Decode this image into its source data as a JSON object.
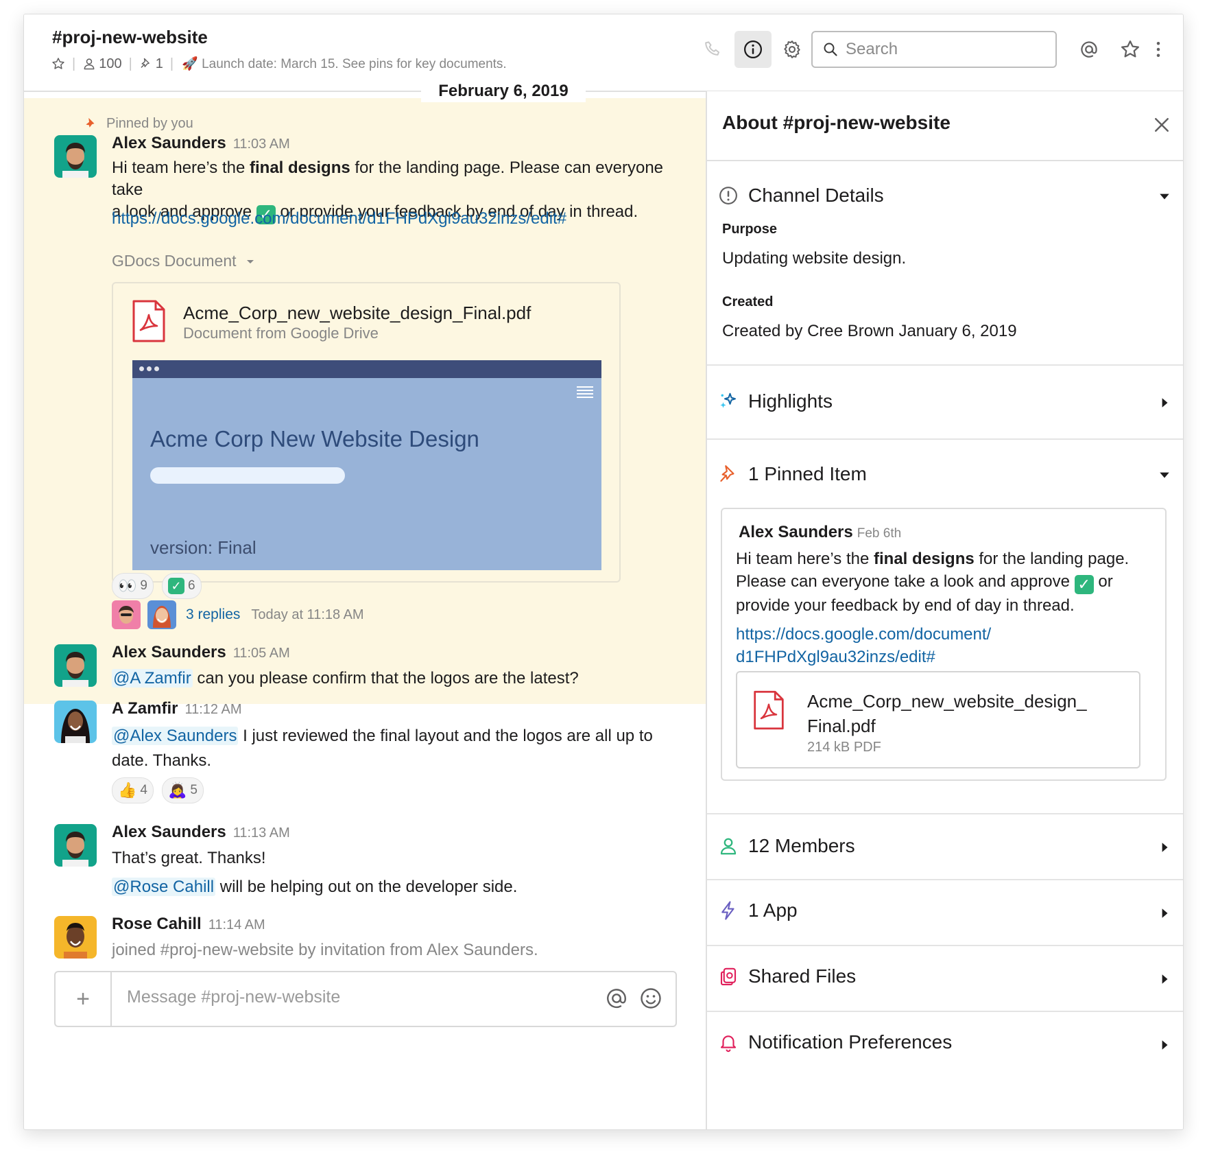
{
  "header": {
    "channel_name": "#proj-new-website",
    "member_count": "100",
    "pin_count": "1",
    "topic": "Launch date: March 15. See pins for key documents.",
    "topic_emoji": "🚀",
    "search_placeholder": "Search",
    "icons": [
      "star-icon",
      "person-icon",
      "pin-icon",
      "phone-icon",
      "info-icon",
      "gear-icon",
      "search-icon",
      "at-icon",
      "star-outline-icon",
      "more-vertical-icon"
    ]
  },
  "date_divider": "February 6, 2019",
  "messages": {
    "pinned_by": "Pinned by you",
    "m1": {
      "author": "Alex Saunders",
      "time": "11:03 AM",
      "text_a": "Hi team here’s the ",
      "text_bold": "final designs",
      "text_b": " for the landing page. Please can everyone take",
      "text_c": "a look and approve ",
      "text_d": " or provide your feedback by end of day in thread.",
      "link": "https://docs.google.com/document/d1FHPdXgl9au32inzs/edit#",
      "attachment_label": "GDocs Document",
      "file_name": "Acme_Corp_new_website_design_Final.pdf",
      "file_source": "Document from Google Drive",
      "preview_title": "Acme Corp New Website Design",
      "preview_version": "version: Final",
      "reactions": [
        {
          "emoji": "👀",
          "count": "9"
        },
        {
          "emoji": "✓",
          "count": "6"
        }
      ],
      "replies": "3 replies",
      "replies_time": "Today at 11:18 AM"
    },
    "m2": {
      "author": "Alex Saunders",
      "time": "11:05 AM",
      "mention": "@A Zamfir",
      "text": " can you please confirm that the logos are the latest?"
    },
    "m3": {
      "author": "A Zamfir",
      "time": "11:12 AM",
      "mention": "@Alex Saunders",
      "text_a": " I just reviewed the final layout and the logos are all up to",
      "text_b": "date. Thanks.",
      "reactions": [
        {
          "emoji": "👍",
          "count": "4"
        },
        {
          "emoji": "🙇‍♀️",
          "count": "5"
        }
      ]
    },
    "m4": {
      "author": "Alex Saunders",
      "time": "11:13 AM",
      "text": "That’s great. Thanks!",
      "mention": "@Rose Cahill",
      "text_b": " will be helping out on the developer side."
    },
    "m5": {
      "author": "Rose Cahill",
      "time": "11:14 AM",
      "text": "joined #proj-new-website by invitation from Alex Saunders."
    }
  },
  "composer": {
    "placeholder": "Message #proj-new-website",
    "plus": "+"
  },
  "panel": {
    "title": "About #proj-new-website",
    "channel_details": {
      "label": "Channel Details",
      "purpose_label": "Purpose",
      "purpose": "Updating website design.",
      "created_label": "Created",
      "created": "Created by Cree Brown January 6, 2019"
    },
    "highlights": "Highlights",
    "pinned": {
      "label": "1 Pinned Item",
      "author": "Alex Saunders",
      "date": "Feb 6th",
      "text_a": "Hi team here’s the ",
      "text_bold": "final designs",
      "text_b": " for the landing page. Please can everyone take a look and approve ",
      "text_c": " or provide your feedback by end of day in thread.",
      "link_a": "https://docs.google.com/document/",
      "link_b": "d1FHPdXgl9au32inzs/edit#",
      "file_name_a": "Acme_Corp_new_website_design_",
      "file_name_b": "Final.pdf",
      "file_size": "214 kB PDF"
    },
    "members": "12 Members",
    "apps": "1 App",
    "shared_files": "Shared Files",
    "notifications": "Notification Preferences"
  },
  "colors": {
    "link": "#1264a3",
    "pinned_bg": "#fdf7e1",
    "check_green": "#2eb67d",
    "pin_orange": "#e8602c"
  }
}
